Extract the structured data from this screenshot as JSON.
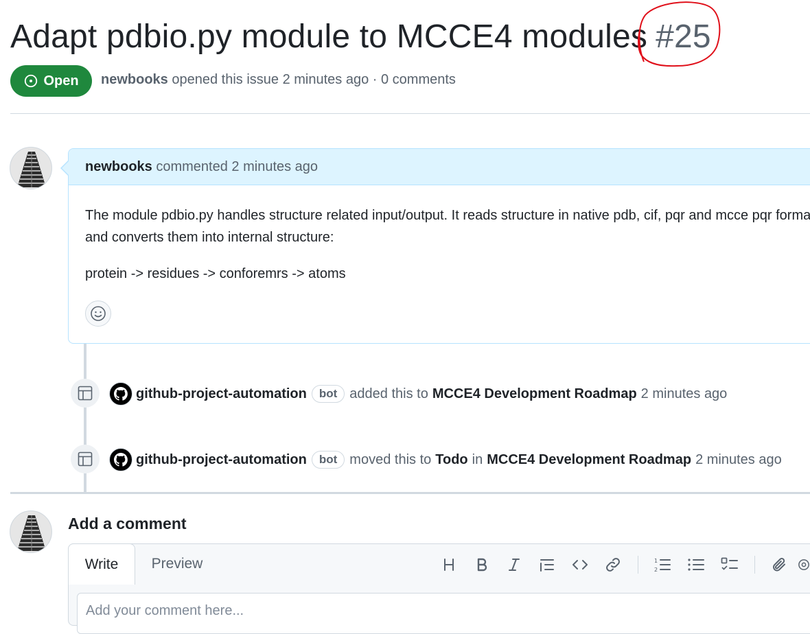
{
  "issue": {
    "title": "Adapt pdbio.py module to MCCE4 modules",
    "number": "#25",
    "state": "Open",
    "author": "newbooks",
    "meta_rest": "opened this issue 2 minutes ago · 0 comments"
  },
  "comment": {
    "author": "newbooks",
    "header_rest": "commented 2 minutes ago",
    "body_paragraph_1": "The module pdbio.py handles structure related input/output. It reads structure in native pdb, cif, pqr and mcce pqr format and converts them into internal structure:",
    "body_paragraph_2": "protein -> residues -> conforemrs -> atoms"
  },
  "timeline": [
    {
      "actor": "github-project-automation",
      "badge": "bot",
      "action": "added this to",
      "target": "MCCE4 Development Roadmap",
      "time": "2 minutes ago"
    },
    {
      "actor": "github-project-automation",
      "badge": "bot",
      "action": "moved this to",
      "column": "Todo",
      "connector": "in",
      "target": "MCCE4 Development Roadmap",
      "time": "2 minutes ago"
    }
  ],
  "add_comment": {
    "title": "Add a comment",
    "tab_write": "Write",
    "tab_preview": "Preview",
    "placeholder": "Add your comment here..."
  },
  "toolbar_icons": [
    "heading-icon",
    "bold-icon",
    "italic-icon",
    "quote-icon",
    "code-icon",
    "link-icon",
    "numbered-list-icon",
    "bulleted-list-icon",
    "task-list-icon",
    "attach-icon",
    "mention-icon"
  ],
  "colors": {
    "open_green": "#1f883d",
    "comment_header_bg": "#ddf4ff",
    "comment_border": "#b6e3ff",
    "annotation_red": "#e0101a"
  }
}
